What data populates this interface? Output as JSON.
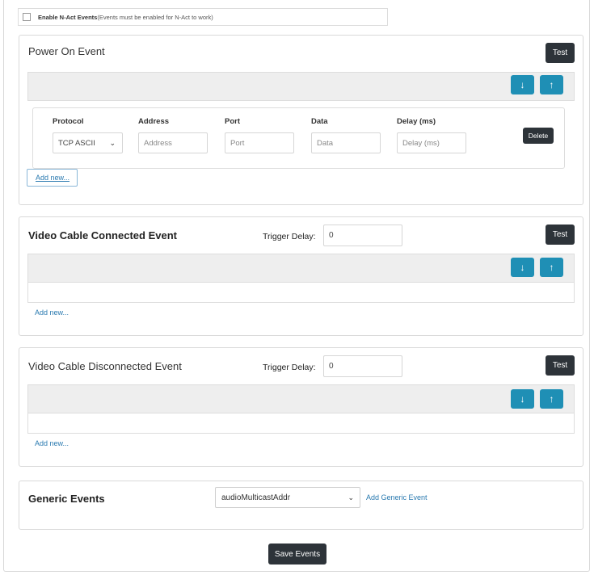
{
  "enable": {
    "label": "Enable N-Act Events",
    "note": "(Events must be enabled for N-Act to work)"
  },
  "power_on": {
    "title": "Power On Event",
    "test_label": "Test",
    "columns": [
      "Protocol",
      "Address",
      "Port",
      "Data",
      "Delay (ms)"
    ],
    "protocol_value": "TCP ASCII",
    "address_placeholder": "Address",
    "port_placeholder": "Port",
    "data_placeholder": "Data",
    "delay_placeholder": "Delay (ms)",
    "delete_label": "Delete",
    "add_new": "Add new..."
  },
  "video_connected": {
    "title": "Video Cable Connected Event",
    "trigger_label": "Trigger Delay:",
    "trigger_value": "0",
    "test_label": "Test",
    "add_new": "Add new..."
  },
  "video_disconnected": {
    "title": "Video Cable Disconnected Event",
    "trigger_label": "Trigger Delay:",
    "trigger_value": "0",
    "test_label": "Test",
    "add_new": "Add new..."
  },
  "generic": {
    "title": "Generic Events",
    "select_value": "audioMulticastAddr",
    "add_label": "Add Generic Event"
  },
  "save_label": "Save Events",
  "icons": {
    "move_down": "arrow-down-icon",
    "move_up": "arrow-up-icon",
    "dropdown": "chevron-down-icon"
  },
  "colors": {
    "accent": "#1f8fb5",
    "dark_button": "#2d3339",
    "link": "#2a7ab0"
  }
}
